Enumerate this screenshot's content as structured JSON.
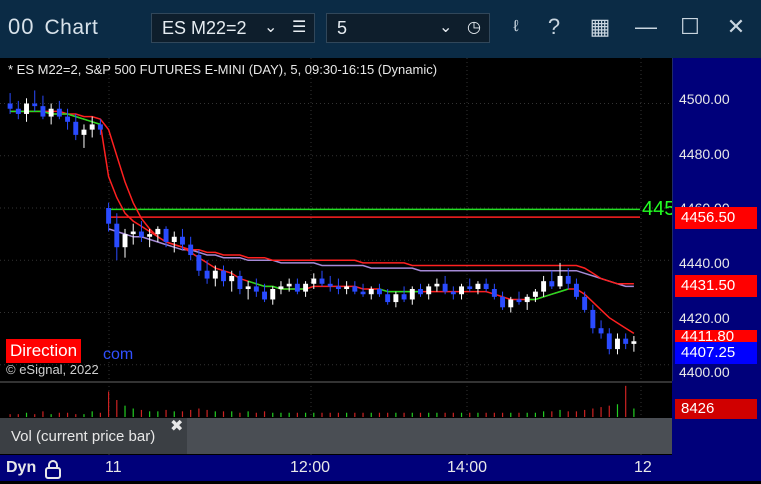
{
  "window": {
    "title": "Chart",
    "icon_glyph": "00",
    "symbol": "ES M22=2",
    "interval": "5"
  },
  "chart_header": "* ES M22=2, S&P 500 FUTURES E-MINI (DAY), 5, 09:30-16:15 (Dynamic)",
  "price_axis": {
    "ticks": [
      "4500.00",
      "4480.00",
      "4460.00",
      "4440.00",
      "4420.00",
      "4400.00"
    ],
    "tick_values": [
      4500,
      4480,
      4460,
      4440,
      4420,
      4400
    ]
  },
  "price_boxes": [
    {
      "label": "4456.50",
      "value": 4456.5,
      "color": "#ff0000",
      "text": "#ffffff"
    },
    {
      "label": "4431.50",
      "value": 4431.5,
      "color": "#ff0000",
      "text": "#ffffff"
    },
    {
      "label": "4411.80",
      "value": 4411.8,
      "color": "#ff0000",
      "text": "#ffffff"
    },
    {
      "label": "4407.25",
      "value": 4407.25,
      "color": "#0000ff",
      "text": "#ffffff"
    }
  ],
  "green_level_label": "445",
  "direction_label": "Direction",
  "direction_tail": "com",
  "copyright": "© eSignal, 2022",
  "volume_panel": {
    "label": "Vol (current price bar)",
    "close_glyph": "✖",
    "value": "8426"
  },
  "time_axis": {
    "mode": "Dyn",
    "labels": [
      "11",
      "12:00",
      "14:00",
      "12"
    ]
  },
  "colors": {
    "titlebar": "#0b2b45",
    "axis_bg": "#00007a",
    "bull": "#ffffff",
    "bear": "#2a4bff",
    "ma_red": "#ff2020",
    "ma_green": "#22dd22",
    "ma_purple": "#a58ad6"
  },
  "chart_data": {
    "type": "candlestick",
    "y_range": [
      4398,
      4509
    ],
    "y_axis_side": "right",
    "grid": true,
    "candles": [
      [
        4500,
        4504,
        4496,
        4498
      ],
      [
        4498,
        4501,
        4494,
        4496
      ],
      [
        4496,
        4502,
        4493,
        4500
      ],
      [
        4500,
        4505,
        4497,
        4499
      ],
      [
        4499,
        4503,
        4494,
        4495
      ],
      [
        4495,
        4500,
        4492,
        4498
      ],
      [
        4498,
        4501,
        4494,
        4495
      ],
      [
        4495,
        4498,
        4490,
        4493
      ],
      [
        4493,
        4496,
        4486,
        4488
      ],
      [
        4488,
        4492,
        4483,
        4490
      ],
      [
        4490,
        4495,
        4487,
        4492
      ],
      [
        4492,
        4494,
        4488,
        4490
      ],
      [
        4460,
        4462,
        4451,
        4454
      ],
      [
        4454,
        4458,
        4440,
        4445
      ],
      [
        4445,
        4452,
        4441,
        4450
      ],
      [
        4450,
        4454,
        4446,
        4451
      ],
      [
        4451,
        4455,
        4447,
        4449
      ],
      [
        4449,
        4452,
        4445,
        4450
      ],
      [
        4450,
        4453,
        4447,
        4452
      ],
      [
        4452,
        4453,
        4445,
        4447
      ],
      [
        4447,
        4451,
        4443,
        4449
      ],
      [
        4449,
        4452,
        4444,
        4446
      ],
      [
        4446,
        4449,
        4440,
        4442
      ],
      [
        4442,
        4444,
        4434,
        4436
      ],
      [
        4436,
        4440,
        4431,
        4433
      ],
      [
        4433,
        4438,
        4430,
        4436
      ],
      [
        4436,
        4438,
        4430,
        4432
      ],
      [
        4432,
        4436,
        4428,
        4434
      ],
      [
        4434,
        4436,
        4427,
        4429
      ],
      [
        4429,
        4432,
        4425,
        4430
      ],
      [
        4430,
        4433,
        4426,
        4428
      ],
      [
        4428,
        4431,
        4424,
        4425
      ],
      [
        4425,
        4430,
        4423,
        4429
      ],
      [
        4429,
        4432,
        4427,
        4430
      ],
      [
        4430,
        4433,
        4428,
        4431
      ],
      [
        4431,
        4433,
        4427,
        4428
      ],
      [
        4428,
        4432,
        4426,
        4431
      ],
      [
        4431,
        4435,
        4429,
        4433
      ],
      [
        4433,
        4436,
        4430,
        4431
      ],
      [
        4431,
        4434,
        4428,
        4430
      ],
      [
        4430,
        4433,
        4427,
        4429
      ],
      [
        4429,
        4432,
        4427,
        4430
      ],
      [
        4430,
        4432,
        4427,
        4428
      ],
      [
        4428,
        4431,
        4426,
        4427
      ],
      [
        4427,
        4430,
        4425,
        4429
      ],
      [
        4429,
        4431,
        4426,
        4427
      ],
      [
        4427,
        4429,
        4423,
        4424
      ],
      [
        4424,
        4428,
        4422,
        4427
      ],
      [
        4427,
        4430,
        4424,
        4425
      ],
      [
        4425,
        4430,
        4423,
        4429
      ],
      [
        4429,
        4431,
        4426,
        4427
      ],
      [
        4427,
        4431,
        4425,
        4430
      ],
      [
        4430,
        4433,
        4428,
        4431
      ],
      [
        4431,
        4434,
        4427,
        4428
      ],
      [
        4428,
        4430,
        4425,
        4427
      ],
      [
        4427,
        4431,
        4425,
        4430
      ],
      [
        4430,
        4433,
        4428,
        4429
      ],
      [
        4429,
        4432,
        4427,
        4431
      ],
      [
        4431,
        4433,
        4428,
        4429
      ],
      [
        4429,
        4431,
        4425,
        4426
      ],
      [
        4426,
        4428,
        4421,
        4422
      ],
      [
        4422,
        4426,
        4420,
        4425
      ],
      [
        4425,
        4428,
        4423,
        4424
      ],
      [
        4424,
        4427,
        4421,
        4426
      ],
      [
        4426,
        4429,
        4424,
        4428
      ],
      [
        4428,
        4434,
        4426,
        4432
      ],
      [
        4432,
        4436,
        4429,
        4430
      ],
      [
        4430,
        4439,
        4429,
        4434
      ],
      [
        4434,
        4437,
        4429,
        4431
      ],
      [
        4431,
        4433,
        4425,
        4426
      ],
      [
        4426,
        4428,
        4420,
        4421
      ],
      [
        4421,
        4423,
        4412,
        4414
      ],
      [
        4414,
        4417,
        4410,
        4412
      ],
      [
        4412,
        4414,
        4404,
        4406
      ],
      [
        4406,
        4412,
        4404,
        4410
      ],
      [
        4410,
        4412,
        4406,
        4408
      ],
      [
        4408,
        4411,
        4405,
        4409
      ]
    ],
    "horizontal_levels": [
      {
        "value": 4459.5,
        "color": "#22dd22"
      },
      {
        "value": 4456.5,
        "color": "#ff2020"
      }
    ],
    "ma_fast": [
      4497,
      4497,
      4497,
      4497,
      4497,
      4496,
      4496,
      4496,
      4495,
      4494,
      4493,
      4492,
      4472,
      4464,
      4458,
      4455,
      4453,
      4451,
      4449,
      4447,
      4446,
      4445,
      4443,
      4441,
      4439,
      4437,
      4436,
      4435,
      4433,
      4432,
      4431,
      4430,
      4430,
      4429,
      4429,
      4429,
      4429,
      4430,
      4430,
      4430,
      4430,
      4430,
      4430,
      4429,
      4429,
      4429,
      4428,
      4428,
      4428,
      4428,
      4428,
      4428,
      4428,
      4428,
      4428,
      4428,
      4428,
      4428,
      4428,
      4427,
      4426,
      4425,
      4425,
      4425,
      4425,
      4426,
      4427,
      4428,
      4429,
      4429,
      4427,
      4424,
      4421,
      4418,
      4416,
      4414,
      4412
    ],
    "ma_slow": [
      4497,
      4497,
      4497,
      4497,
      4497,
      4497,
      4497,
      4496,
      4496,
      4495,
      4495,
      4494,
      4490,
      4480,
      4470,
      4462,
      4456,
      4452,
      4449,
      4447,
      4446,
      4445,
      4444,
      4444,
      4443,
      4443,
      4442,
      4442,
      4442,
      4441,
      4441,
      4441,
      4440,
      4440,
      4440,
      4440,
      4440,
      4440,
      4440,
      4440,
      4440,
      4440,
      4440,
      4439,
      4439,
      4439,
      4439,
      4439,
      4439,
      4438,
      4438,
      4438,
      4438,
      4438,
      4438,
      4438,
      4438,
      4438,
      4438,
      4438,
      4438,
      4438,
      4438,
      4438,
      4438,
      4438,
      4438,
      4438,
      4438,
      4438,
      4437,
      4435,
      4433,
      4432,
      4431,
      4431,
      4431
    ],
    "ma_purple": [
      null,
      null,
      null,
      null,
      null,
      null,
      null,
      null,
      null,
      null,
      null,
      null,
      4452,
      4451,
      4450,
      4449,
      4449,
      4448,
      4447,
      4446,
      4445,
      4444,
      4444,
      4443,
      4442,
      4442,
      4441,
      4441,
      4441,
      4440,
      4440,
      4440,
      4440,
      4439,
      4439,
      4439,
      4439,
      4439,
      4438,
      4438,
      4438,
      4438,
      4438,
      4438,
      4437,
      4437,
      4437,
      4437,
      4437,
      4437,
      4436,
      4436,
      4436,
      4436,
      4436,
      4436,
      4436,
      4436,
      4436,
      4436,
      4436,
      4436,
      4436,
      4436,
      4436,
      4436,
      4436,
      4436,
      4436,
      4436,
      4435,
      4434,
      4433,
      4432,
      4431,
      4430,
      4430
    ],
    "volume": [
      2,
      2,
      3,
      2,
      4,
      2,
      3,
      3,
      2,
      2,
      4,
      3,
      18,
      12,
      8,
      6,
      5,
      4,
      4,
      5,
      4,
      4,
      5,
      6,
      5,
      4,
      4,
      4,
      3,
      4,
      3,
      4,
      3,
      3,
      3,
      3,
      3,
      3,
      3,
      3,
      3,
      3,
      3,
      3,
      3,
      3,
      3,
      3,
      3,
      3,
      3,
      3,
      3,
      3,
      3,
      3,
      3,
      3,
      3,
      3,
      3,
      3,
      3,
      3,
      3,
      4,
      4,
      5,
      4,
      4,
      5,
      6,
      7,
      8,
      9,
      22,
      6
    ]
  }
}
